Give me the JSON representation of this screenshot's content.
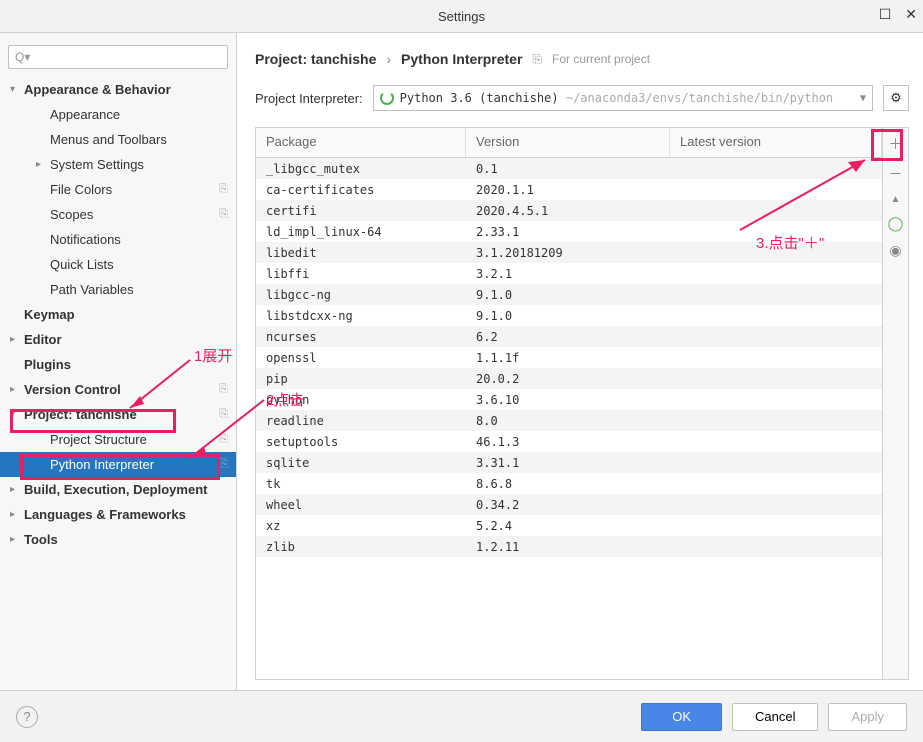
{
  "titlebar": {
    "title": "Settings",
    "maximize": "☐",
    "close": "✕"
  },
  "search": {
    "placeholder": "Q▾"
  },
  "sidebar": {
    "items": [
      {
        "label": "Appearance & Behavior",
        "bold": true,
        "arrow": "▾"
      },
      {
        "label": "Appearance",
        "sub": true
      },
      {
        "label": "Menus and Toolbars",
        "sub": true
      },
      {
        "label": "System Settings",
        "sub": true,
        "arrow": "▸"
      },
      {
        "label": "File Colors",
        "sub": true,
        "proj": true
      },
      {
        "label": "Scopes",
        "sub": true,
        "proj": true
      },
      {
        "label": "Notifications",
        "sub": true
      },
      {
        "label": "Quick Lists",
        "sub": true
      },
      {
        "label": "Path Variables",
        "sub": true
      },
      {
        "label": "Keymap",
        "bold": true
      },
      {
        "label": "Editor",
        "bold": true,
        "arrow": "▸"
      },
      {
        "label": "Plugins",
        "bold": true
      },
      {
        "label": "Version Control",
        "bold": true,
        "arrow": "▸",
        "proj": true
      },
      {
        "label": "Project: tanchishe",
        "bold": true,
        "arrow": "▾",
        "proj": true
      },
      {
        "label": "Project Structure",
        "sub2": true,
        "proj": true
      },
      {
        "label": "Python Interpreter",
        "sub2": true,
        "proj": true,
        "selected": true
      },
      {
        "label": "Build, Execution, Deployment",
        "bold": true,
        "arrow": "▸"
      },
      {
        "label": "Languages & Frameworks",
        "bold": true,
        "arrow": "▸"
      },
      {
        "label": "Tools",
        "bold": true,
        "arrow": "▸"
      }
    ]
  },
  "breadcrumb": {
    "part1": "Project: tanchishe",
    "sep": "›",
    "part2": "Python Interpreter",
    "forproj_icon": "⎘",
    "forproj": "For current project"
  },
  "interpreter": {
    "label": "Project Interpreter:",
    "name": "Python 3.6 (tanchishe)",
    "path": "~/anaconda3/envs/tanchishe/bin/python"
  },
  "table": {
    "headers": {
      "package": "Package",
      "version": "Version",
      "latest": "Latest version"
    },
    "rows": [
      {
        "p": "_libgcc_mutex",
        "v": "0.1"
      },
      {
        "p": "ca-certificates",
        "v": "2020.1.1"
      },
      {
        "p": "certifi",
        "v": "2020.4.5.1"
      },
      {
        "p": "ld_impl_linux-64",
        "v": "2.33.1"
      },
      {
        "p": "libedit",
        "v": "3.1.20181209"
      },
      {
        "p": "libffi",
        "v": "3.2.1"
      },
      {
        "p": "libgcc-ng",
        "v": "9.1.0"
      },
      {
        "p": "libstdcxx-ng",
        "v": "9.1.0"
      },
      {
        "p": "ncurses",
        "v": "6.2"
      },
      {
        "p": "openssl",
        "v": "1.1.1f"
      },
      {
        "p": "pip",
        "v": "20.0.2"
      },
      {
        "p": "python",
        "v": "3.6.10"
      },
      {
        "p": "readline",
        "v": "8.0"
      },
      {
        "p": "setuptools",
        "v": "46.1.3"
      },
      {
        "p": "sqlite",
        "v": "3.31.1"
      },
      {
        "p": "tk",
        "v": "8.6.8"
      },
      {
        "p": "wheel",
        "v": "0.34.2"
      },
      {
        "p": "xz",
        "v": "5.2.4"
      },
      {
        "p": "zlib",
        "v": "1.2.11"
      }
    ]
  },
  "toolbar": {
    "add": "＋",
    "remove": "－",
    "up": "▲",
    "conda": "◯",
    "eye": "◉"
  },
  "footer": {
    "help": "?",
    "ok": "OK",
    "cancel": "Cancel",
    "apply": "Apply"
  },
  "annotations": {
    "a1": "1展开",
    "a2": "2点击",
    "a3": "3.点击\"＋\""
  }
}
